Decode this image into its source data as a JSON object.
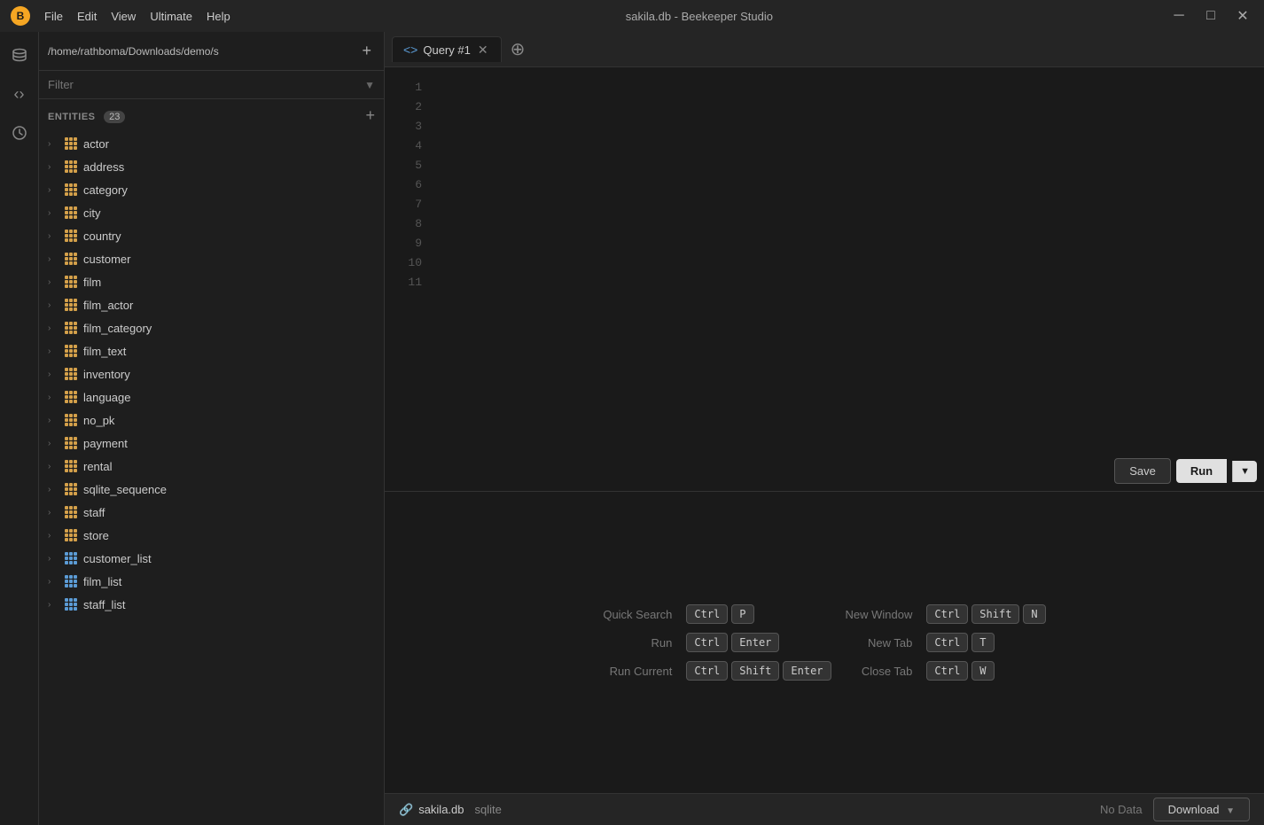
{
  "window": {
    "title": "sakila.db - Beekeeper Studio"
  },
  "titlebar": {
    "menu": [
      "File",
      "Edit",
      "View",
      "Ultimate",
      "Help"
    ],
    "controls": [
      "minimize",
      "maximize",
      "close"
    ]
  },
  "sidebar": {
    "path": "/home/rathboma/Downloads/demo/s",
    "filter_placeholder": "Filter",
    "entities_label": "ENTITIES",
    "entities_count": "23",
    "items": [
      {
        "name": "actor",
        "type": "table"
      },
      {
        "name": "address",
        "type": "table"
      },
      {
        "name": "category",
        "type": "table"
      },
      {
        "name": "city",
        "type": "table"
      },
      {
        "name": "country",
        "type": "table"
      },
      {
        "name": "customer",
        "type": "table"
      },
      {
        "name": "film",
        "type": "table"
      },
      {
        "name": "film_actor",
        "type": "table"
      },
      {
        "name": "film_category",
        "type": "table"
      },
      {
        "name": "film_text",
        "type": "table"
      },
      {
        "name": "inventory",
        "type": "table"
      },
      {
        "name": "language",
        "type": "table"
      },
      {
        "name": "no_pk",
        "type": "table"
      },
      {
        "name": "payment",
        "type": "table"
      },
      {
        "name": "rental",
        "type": "table"
      },
      {
        "name": "sqlite_sequence",
        "type": "table"
      },
      {
        "name": "staff",
        "type": "table"
      },
      {
        "name": "store",
        "type": "table"
      },
      {
        "name": "customer_list",
        "type": "view"
      },
      {
        "name": "film_list",
        "type": "view"
      },
      {
        "name": "staff_list",
        "type": "view"
      }
    ]
  },
  "tab": {
    "label": "Query #1"
  },
  "editor": {
    "lines": [
      "1",
      "2",
      "3",
      "4",
      "5",
      "6",
      "7",
      "8",
      "9",
      "10",
      "11"
    ]
  },
  "toolbar": {
    "save_label": "Save",
    "run_label": "Run"
  },
  "shortcuts": [
    {
      "label": "Quick Search",
      "keys": [
        "Ctrl",
        "P"
      ]
    },
    {
      "label": "Run",
      "keys": [
        "Ctrl",
        "Enter"
      ]
    },
    {
      "label": "Run Current",
      "keys": [
        "Ctrl",
        "Shift",
        "Enter"
      ]
    },
    {
      "label": "New Window",
      "keys": [
        "Ctrl",
        "Shift",
        "N"
      ]
    },
    {
      "label": "New Tab",
      "keys": [
        "Ctrl",
        "T"
      ]
    },
    {
      "label": "Close Tab",
      "keys": [
        "Ctrl",
        "W"
      ]
    }
  ],
  "statusbar": {
    "db_name": "sakila.db",
    "db_type": "sqlite",
    "no_data_label": "No Data",
    "download_label": "Download"
  }
}
